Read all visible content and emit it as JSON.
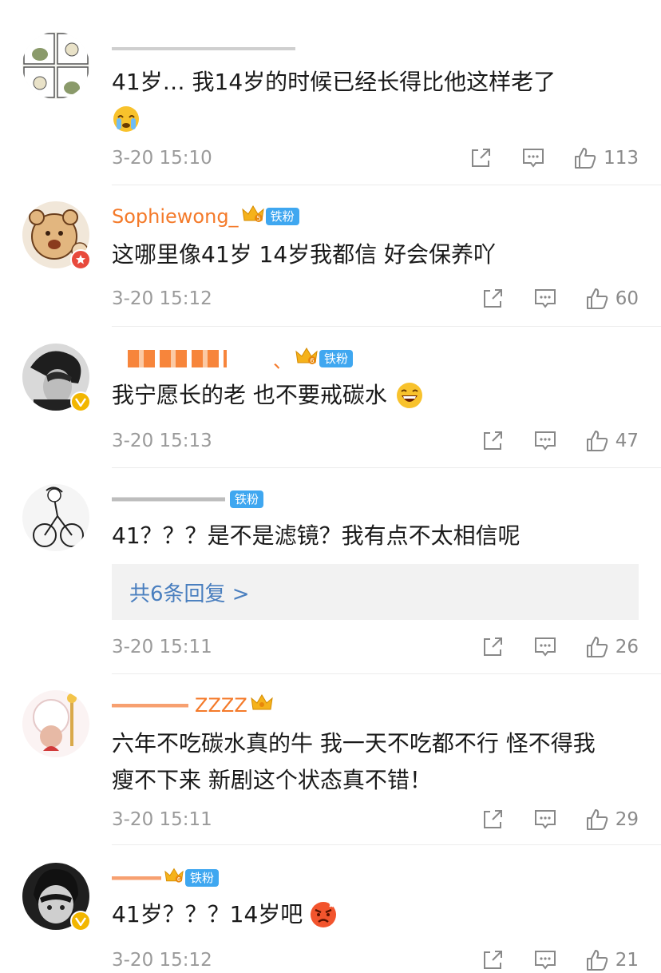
{
  "comments": [
    {
      "name": "",
      "content": "41岁… 我14岁的时候已经长得比他这样老了",
      "content_line2": "",
      "time": "3-20 15:10",
      "likes": "113",
      "emoji": "doraemon-face-icon"
    },
    {
      "name": "Sophiewong_",
      "badge": "铁粉",
      "content": "这哪里像41岁 14岁我都信 好会保养吖",
      "time": "3-20 15:12",
      "likes": "60"
    },
    {
      "name": "、",
      "badge": "铁粉",
      "content": "我宁愿长的老 也不要戒碳水",
      "time": "3-20 15:13",
      "likes": "47"
    },
    {
      "name": "",
      "badge": "铁粉",
      "content": "41？？？是不是滤镜？我有点不太相信呢",
      "replies": "共6条回复 >",
      "time": "3-20 15:11",
      "likes": "26"
    },
    {
      "name": "ZZZZ",
      "content": "六年不吃碳水真的牛 我一天不吃都不行 怪不得我",
      "content_line2": "瘦不下来 新剧这个状态真不错！",
      "time": "3-20 15:11",
      "likes": "29"
    },
    {
      "name": "",
      "badge": "铁粉",
      "content": "41岁？？？14岁吧",
      "time": "3-20 15:12",
      "likes": "21"
    }
  ],
  "colors": {
    "name_orange": "#f47a2a",
    "fan_badge": "#3fa7f0",
    "reply_link": "#4a7fbf",
    "meta_gray": "#9a9a9a"
  }
}
